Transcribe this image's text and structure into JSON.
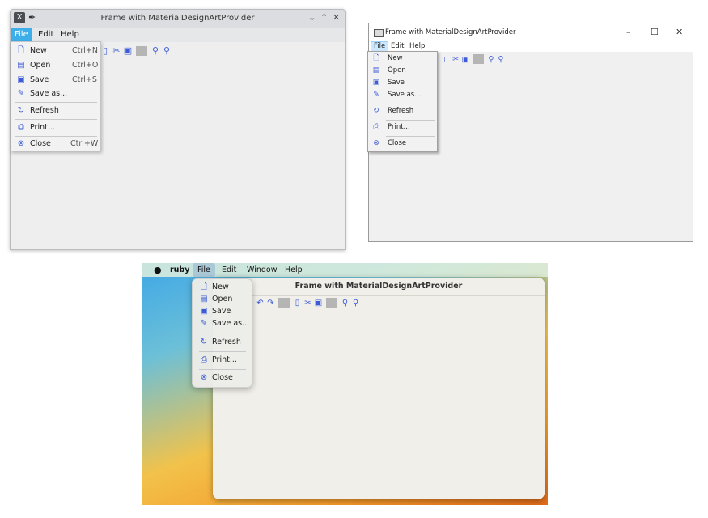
{
  "window_title": "Frame with MaterialDesignArtProvider",
  "menus": [
    "File",
    "Edit",
    "Help"
  ],
  "mac_menus": [
    "ruby",
    "File",
    "Edit",
    "Window",
    "Help"
  ],
  "file_menu": {
    "new": "New",
    "open": "Open",
    "save": "Save",
    "save_as": "Save as...",
    "refresh": "Refresh",
    "print": "Print...",
    "close": "Close"
  },
  "shortcuts": {
    "new": "Ctrl+N",
    "open": "Ctrl+O",
    "save": "Ctrl+S",
    "close": "Ctrl+W"
  },
  "icons": {
    "new": "new-file-icon",
    "open": "open-file-icon",
    "save": "save-icon",
    "save_as": "save-as-icon",
    "refresh": "refresh-icon",
    "print": "print-icon",
    "close": "close-circle-icon",
    "copy": "copy-icon",
    "cut": "cut-icon",
    "paste": "paste-icon",
    "zoom": "search-icon",
    "zoom_out": "zoom-out-icon",
    "undo": "undo-icon",
    "redo": "redo-icon"
  },
  "accent_color": "#3daee9",
  "icon_color": "#3c5bd6"
}
